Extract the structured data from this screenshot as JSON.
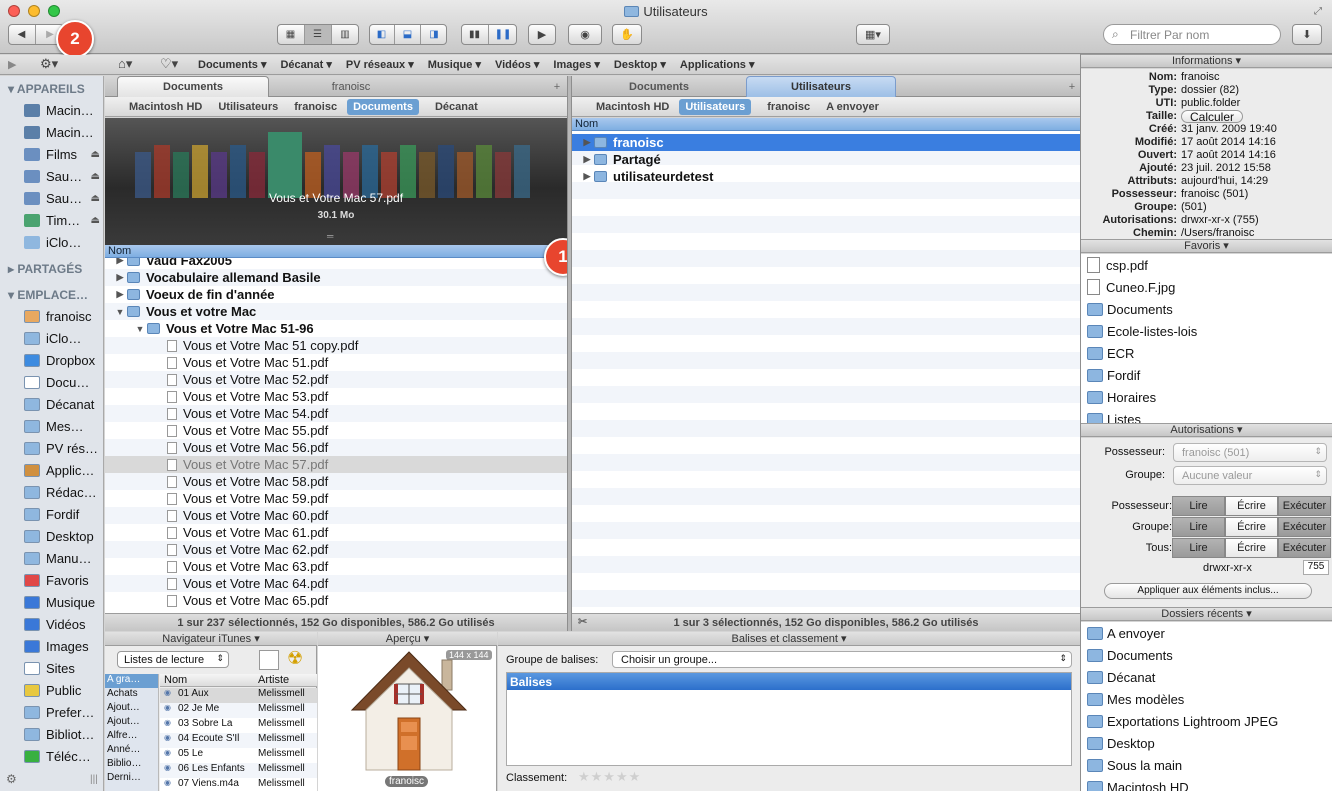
{
  "window": {
    "title": "Utilisateurs"
  },
  "toolbar": {
    "search_placeholder": "Filtrer Par nom"
  },
  "badges": {
    "one": "1",
    "two": "2"
  },
  "pathbar": {
    "items": [
      "Documents",
      "Décanat",
      "PV réseaux",
      "Musique",
      "Vidéos",
      "Images",
      "Desktop",
      "Applications"
    ]
  },
  "sidebar": {
    "sections": {
      "devices": "APPAREILS",
      "shared": "PARTAGÉS",
      "places": "EMPLACE…"
    },
    "devices": [
      "Macin…",
      "Macin…",
      "Films",
      "Sau…",
      "Sau…",
      "Tim…",
      "iClo…"
    ],
    "places": [
      "franoisc",
      "iClo…",
      "Dropbox",
      "Docu…",
      "Décanat",
      "Mes…",
      "PV rés…",
      "Applic…",
      "Rédac…",
      "Fordif",
      "Desktop",
      "Manu…",
      "Favoris",
      "Musique",
      "Vidéos",
      "Images",
      "Sites",
      "Public",
      "Prefer…",
      "Bibliot…",
      "Téléc…"
    ]
  },
  "left_panel": {
    "tabs": [
      "Documents",
      "franoisc"
    ],
    "crumbs": [
      "Macintosh HD",
      "Utilisateurs",
      "franoisc",
      "Documents",
      "Décanat"
    ],
    "preview_file": "Vous et Votre Mac 57.pdf",
    "preview_size": "30.1 Mo",
    "column_header": "Nom",
    "rows": [
      {
        "label": "Vaud Fax2005",
        "level": 0,
        "type": "folder",
        "bold": true
      },
      {
        "label": "Vocabulaire allemand Basile",
        "level": 0,
        "type": "folder",
        "bold": true
      },
      {
        "label": "Voeux de fin d'année",
        "level": 0,
        "type": "folder",
        "bold": true
      },
      {
        "label": "Vous et votre Mac",
        "level": 0,
        "type": "folder",
        "bold": true,
        "open": true
      },
      {
        "label": "Vous et Votre Mac 51-96",
        "level": 1,
        "type": "folder",
        "bold": true,
        "open": true
      },
      {
        "label": "Vous et Votre Mac 51 copy.pdf",
        "level": 2,
        "type": "file"
      },
      {
        "label": "Vous et Votre Mac 51.pdf",
        "level": 2,
        "type": "file"
      },
      {
        "label": "Vous et Votre Mac 52.pdf",
        "level": 2,
        "type": "file"
      },
      {
        "label": "Vous et Votre Mac 53.pdf",
        "level": 2,
        "type": "file"
      },
      {
        "label": "Vous et Votre Mac 54.pdf",
        "level": 2,
        "type": "file"
      },
      {
        "label": "Vous et Votre Mac 55.pdf",
        "level": 2,
        "type": "file"
      },
      {
        "label": "Vous et Votre Mac 56.pdf",
        "level": 2,
        "type": "file"
      },
      {
        "label": "Vous et Votre Mac 57.pdf",
        "level": 2,
        "type": "file",
        "selected": true
      },
      {
        "label": "Vous et Votre Mac 58.pdf",
        "level": 2,
        "type": "file"
      },
      {
        "label": "Vous et Votre Mac 59.pdf",
        "level": 2,
        "type": "file"
      },
      {
        "label": "Vous et Votre Mac 60.pdf",
        "level": 2,
        "type": "file"
      },
      {
        "label": "Vous et Votre Mac 61.pdf",
        "level": 2,
        "type": "file"
      },
      {
        "label": "Vous et Votre Mac 62.pdf",
        "level": 2,
        "type": "file"
      },
      {
        "label": "Vous et Votre Mac 63.pdf",
        "level": 2,
        "type": "file"
      },
      {
        "label": "Vous et Votre Mac 64.pdf",
        "level": 2,
        "type": "file"
      },
      {
        "label": "Vous et Votre Mac 65.pdf",
        "level": 2,
        "type": "file"
      }
    ],
    "status": "1 sur 237 sélectionnés, 152 Go disponibles, 586.2 Go utilisés"
  },
  "right_panel": {
    "tabs": [
      "Documents",
      "Utilisateurs"
    ],
    "crumbs": [
      "Macintosh HD",
      "Utilisateurs",
      "franoisc",
      "A envoyer"
    ],
    "column_header": "Nom",
    "rows": [
      {
        "label": "franoisc",
        "selected": true
      },
      {
        "label": "Partagé"
      },
      {
        "label": "utilisateurdetest"
      }
    ],
    "status": "1 sur 3 sélectionnés, 152 Go disponibles, 586.2 Go utilisés"
  },
  "bottom": {
    "itunes": {
      "title": "Navigateur iTunes",
      "playlist_select": "Listes de lecture",
      "col_name": "Nom",
      "col_artist": "Artiste",
      "playlists": [
        "A gra…",
        "Achats",
        "Ajout…",
        "Ajout…",
        "Alfre…",
        "Anné…",
        "Biblio…",
        "Derni…"
      ],
      "tracks": [
        {
          "name": "01 Aux",
          "artist": "Melissmell"
        },
        {
          "name": "02 Je Me",
          "artist": "Melissmell"
        },
        {
          "name": "03 Sobre La",
          "artist": "Melissmell"
        },
        {
          "name": "04 Ecoute S'Il",
          "artist": "Melissmell"
        },
        {
          "name": "05 Le",
          "artist": "Melissmell"
        },
        {
          "name": "06 Les Enfants",
          "artist": "Melissmell"
        },
        {
          "name": "07 Viens.m4a",
          "artist": "Melissmell"
        }
      ]
    },
    "preview": {
      "title": "Aperçu",
      "dims": "144 x 144",
      "label": "franoisc"
    },
    "tags": {
      "title": "Balises et classement",
      "group_label": "Groupe de balises:",
      "group_select": "Choisir un groupe...",
      "list_header": "Balises",
      "rating_label": "Classement:",
      "stars": "★★★★★"
    }
  },
  "info": {
    "title": "Informations",
    "rows": [
      {
        "k": "Nom:",
        "v": "franoisc"
      },
      {
        "k": "Type:",
        "v": "dossier (82)"
      },
      {
        "k": "UTI:",
        "v": "public.folder"
      },
      {
        "k": "Taille:",
        "v": "Calculer"
      },
      {
        "k": "Créé:",
        "v": "31 janv. 2009 19:40"
      },
      {
        "k": "Modifié:",
        "v": "17 août 2014 14:16"
      },
      {
        "k": "Ouvert:",
        "v": "17 août 2014 14:16"
      },
      {
        "k": "Ajouté:",
        "v": "23 juil. 2012 15:58"
      },
      {
        "k": "Attributs:",
        "v": "aujourd'hui, 14:29"
      },
      {
        "k": "Possesseur:",
        "v": "franoisc (501)"
      },
      {
        "k": "Groupe:",
        "v": "(501)"
      },
      {
        "k": "Autorisations:",
        "v": "drwxr-xr-x (755)"
      },
      {
        "k": "Chemin:",
        "v": "/Users/franoisc"
      }
    ]
  },
  "favoris": {
    "title": "Favoris",
    "items": [
      {
        "label": "csp.pdf",
        "type": "doc"
      },
      {
        "label": "Cuneo.F.jpg",
        "type": "doc"
      },
      {
        "label": "Documents",
        "type": "folder"
      },
      {
        "label": "Ecole-listes-lois",
        "type": "folder"
      },
      {
        "label": "ECR",
        "type": "folder"
      },
      {
        "label": "Fordif",
        "type": "folder"
      },
      {
        "label": "Horaires",
        "type": "folder"
      },
      {
        "label": "Listes",
        "type": "folder"
      }
    ]
  },
  "autorisations": {
    "title": "Autorisations",
    "owner_label": "Possesseur:",
    "owner_value": "franoisc (501)",
    "group_label": "Groupe:",
    "group_value": "Aucune valeur",
    "matrix_rows": [
      "Possesseur:",
      "Groupe:",
      "Tous:"
    ],
    "perm_cols": [
      "Lire",
      "Écrire",
      "Exécuter"
    ],
    "mode": "drwxr-xr-x",
    "octal": "755",
    "apply": "Appliquer aux éléments inclus..."
  },
  "recent": {
    "title": "Dossiers récents",
    "items": [
      "A envoyer",
      "Documents",
      "Décanat",
      "Mes modèles",
      "Exportations Lightroom JPEG",
      "Desktop",
      "Sous la main",
      "Macintosh HD"
    ]
  }
}
